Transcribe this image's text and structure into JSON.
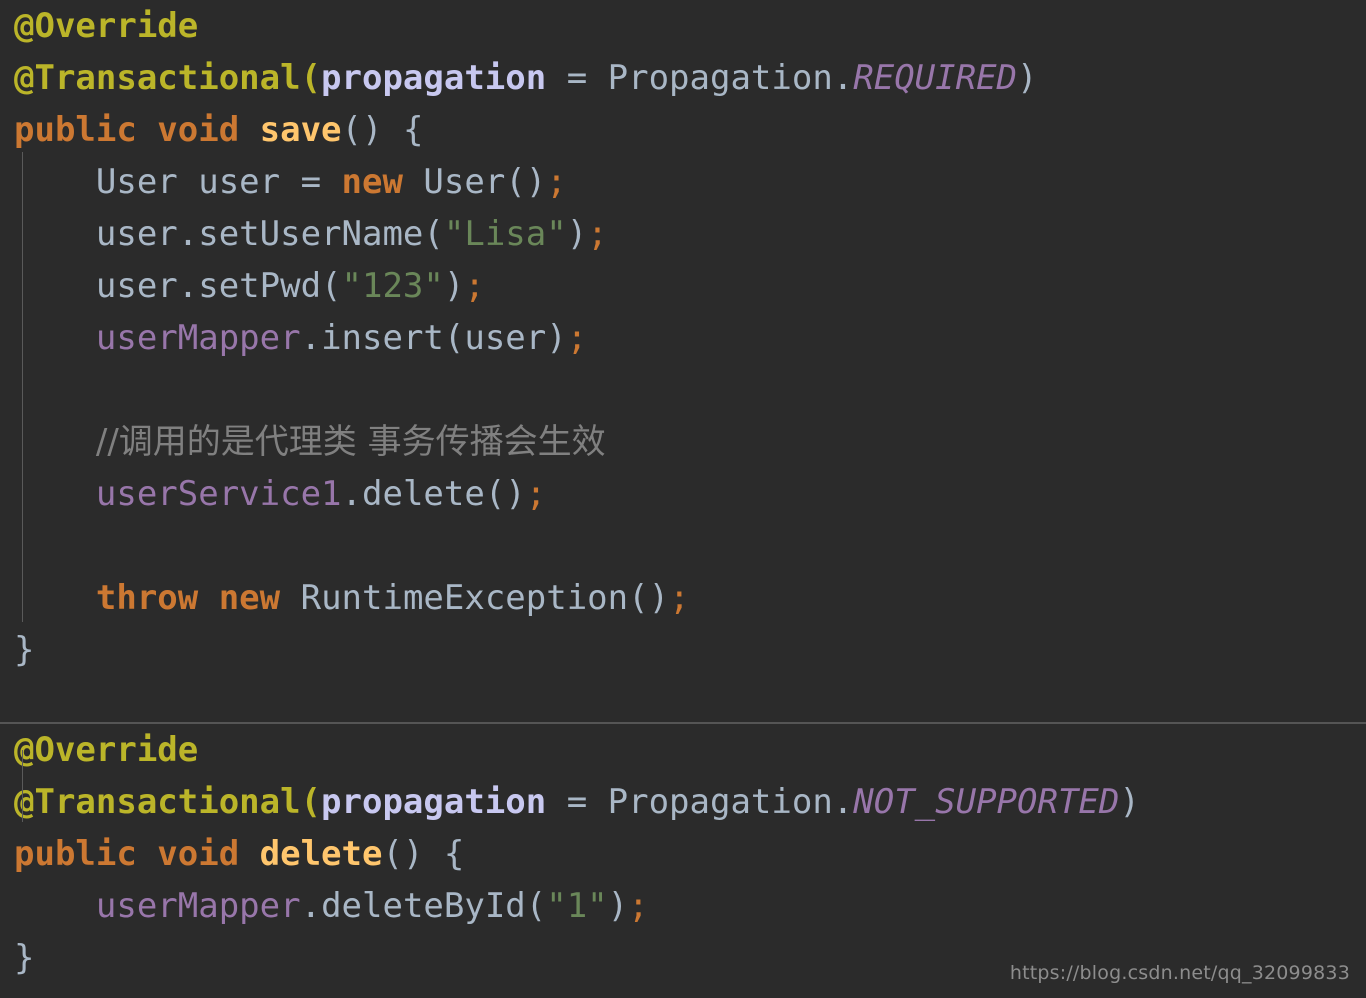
{
  "editor": {
    "background": "#2b2b2b",
    "default_text_color": "#a9b7c6",
    "language": "Java",
    "theme": "Darcula"
  },
  "colors": {
    "annotation": "#bbb529",
    "keyword": "#cc7832",
    "method_name": "#ffc66d",
    "parameter": "#c8c8f0",
    "constant": "#9876aa",
    "field": "#9876aa",
    "string": "#6a8759",
    "semicolon": "#cc7832",
    "comment": "#808080",
    "indent_guide": "#5a5a5a",
    "divider": "#555555",
    "watermark": "#8d8d8d"
  },
  "blocks": [
    {
      "id": "save-method-block",
      "lines": [
        {
          "id": "l1",
          "text": "@Override"
        },
        {
          "id": "l2a",
          "text": "@Transactional("
        },
        {
          "id": "l2b",
          "text": "propagation"
        },
        {
          "id": "l2c",
          "text": " = Propagation."
        },
        {
          "id": "l2d",
          "text": "REQUIRED"
        },
        {
          "id": "l2e",
          "text": ")"
        },
        {
          "id": "l3a",
          "text": "public void "
        },
        {
          "id": "l3b",
          "text": "save"
        },
        {
          "id": "l3c",
          "text": "() {"
        },
        {
          "id": "l4a",
          "text": "    User user = "
        },
        {
          "id": "l4b",
          "text": "new"
        },
        {
          "id": "l4c",
          "text": " User()"
        },
        {
          "id": "l4d",
          "text": ";"
        },
        {
          "id": "l5a",
          "text": "    user.setUserName("
        },
        {
          "id": "l5b",
          "text": "\"Lisa\""
        },
        {
          "id": "l5c",
          "text": ")"
        },
        {
          "id": "l5d",
          "text": ";"
        },
        {
          "id": "l6a",
          "text": "    user.setPwd("
        },
        {
          "id": "l6b",
          "text": "\"123\""
        },
        {
          "id": "l6c",
          "text": ")"
        },
        {
          "id": "l6d",
          "text": ";"
        },
        {
          "id": "l7a",
          "text": "    "
        },
        {
          "id": "l7b",
          "text": "userMapper"
        },
        {
          "id": "l7c",
          "text": ".insert(user)"
        },
        {
          "id": "l7d",
          "text": ";"
        },
        {
          "id": "l8",
          "text": ""
        },
        {
          "id": "l9a",
          "text": "    "
        },
        {
          "id": "l9b",
          "text": "//调用的是代理类 事务传播会生效"
        },
        {
          "id": "l10a",
          "text": "    "
        },
        {
          "id": "l10b",
          "text": "userService1"
        },
        {
          "id": "l10c",
          "text": ".delete()"
        },
        {
          "id": "l10d",
          "text": ";"
        },
        {
          "id": "l11",
          "text": ""
        },
        {
          "id": "l12a",
          "text": "    "
        },
        {
          "id": "l12b",
          "text": "throw new"
        },
        {
          "id": "l12c",
          "text": " RuntimeException()"
        },
        {
          "id": "l12d",
          "text": ";"
        },
        {
          "id": "l13",
          "text": "}"
        }
      ]
    },
    {
      "id": "delete-method-block",
      "lines": [
        {
          "id": "m1",
          "text": "@Override"
        },
        {
          "id": "m2a",
          "text": "@Transactional("
        },
        {
          "id": "m2b",
          "text": "propagation"
        },
        {
          "id": "m2c",
          "text": " = Propagation."
        },
        {
          "id": "m2d",
          "text": "NOT_SUPPORTED"
        },
        {
          "id": "m2e",
          "text": ")"
        },
        {
          "id": "m3a",
          "text": "public void "
        },
        {
          "id": "m3b",
          "text": "delete"
        },
        {
          "id": "m3c",
          "text": "() {"
        },
        {
          "id": "m4a",
          "text": "    "
        },
        {
          "id": "m4b",
          "text": "userMapper"
        },
        {
          "id": "m4c",
          "text": ".deleteById("
        },
        {
          "id": "m4d",
          "text": "\"1\""
        },
        {
          "id": "m4e",
          "text": ")"
        },
        {
          "id": "m4f",
          "text": ";"
        },
        {
          "id": "m5",
          "text": "}"
        }
      ]
    }
  ],
  "watermark": {
    "text": "https://blog.csdn.net/qq_32099833"
  }
}
